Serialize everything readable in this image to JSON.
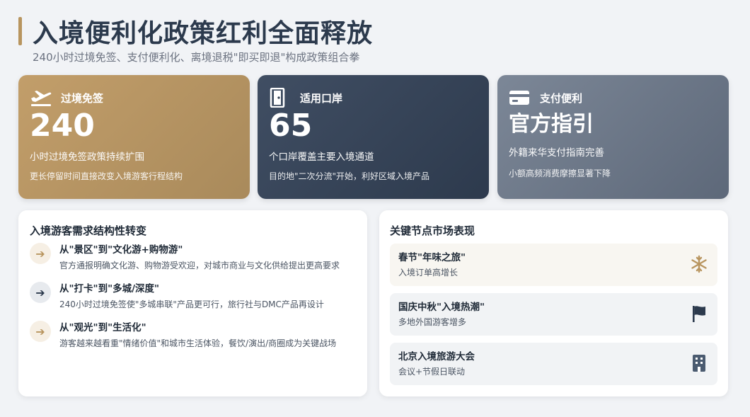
{
  "header": {
    "title": "入境便利化政策红利全面释放",
    "subtitle": "240小时过境免签、支付便利化、离境退税\"即买即退\"构成政策组合拳"
  },
  "cards": [
    {
      "icon": "airplane-departure-icon",
      "label": "过境免签",
      "big": "240",
      "desc": "小时过境免签政策持续扩围",
      "note": "更长停留时间直接改变入境游客行程结构"
    },
    {
      "icon": "door-icon",
      "label": "适用口岸",
      "big": "65",
      "desc": "个口岸覆盖主要入境通道",
      "note": "目的地\"二次分流\"开始，利好区域入境产品"
    },
    {
      "icon": "credit-card-icon",
      "label": "支付便利",
      "big": "官方指引",
      "desc": "外籍来华支付指南完善",
      "note": "小额高频消费摩擦显著下降"
    }
  ],
  "demand": {
    "title": "入境游客需求结构性转变",
    "items": [
      {
        "icon": "arrow-right-icon",
        "title": "从\"景区\"到\"文化游+购物游\"",
        "text": "官方通报明确文化游、购物游受欢迎，对城市商业与文化供给提出更高要求"
      },
      {
        "icon": "arrow-right-icon",
        "title": "从\"打卡\"到\"多城/深度\"",
        "text": "240小时过境免签使\"多城串联\"产品更可行，旅行社与DMC产品再设计"
      },
      {
        "icon": "arrow-right-icon",
        "title": "从\"观光\"到\"生活化\"",
        "text": "游客越来越看重\"情绪价值\"和城市生活体验，餐饮/演出/商圈成为关键战场"
      }
    ]
  },
  "events": {
    "title": "关键节点市场表现",
    "items": [
      {
        "icon": "snowflake-icon",
        "title": "春节\"年味之旅\"",
        "sub": "入境订单高增长"
      },
      {
        "icon": "flag-icon",
        "title": "国庆中秋\"入境热潮\"",
        "sub": "多地外国游客增多"
      },
      {
        "icon": "building-icon",
        "title": "北京入境旅游大会",
        "sub": "会议+节假日联动"
      }
    ]
  },
  "colors": {
    "gold": "#b8955f",
    "navy": "#2c3a4d",
    "slate": "#6b7688",
    "background": "#f1f3f6"
  }
}
